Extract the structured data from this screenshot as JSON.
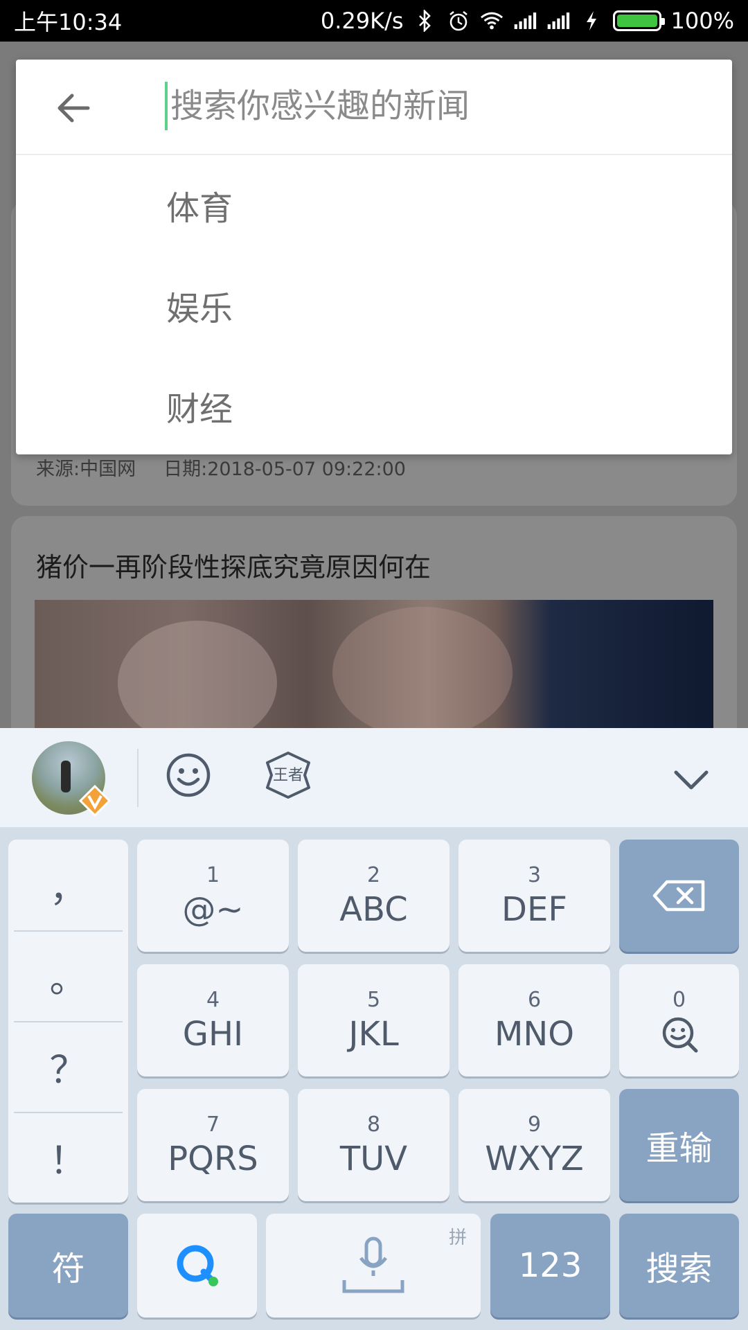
{
  "status_bar": {
    "time": "上午10:34",
    "net_speed": "0.29K/s",
    "battery": "100%",
    "battery_color": "#3ec43e"
  },
  "background": {
    "card1_meta": {
      "source": "来源:中国网",
      "date": "日期:2018-05-07 09:22:00"
    },
    "card2_title": "猪价一再阶段性探底究竟原因何在"
  },
  "search": {
    "back_icon": "arrow-left-icon",
    "placeholder": "搜索你感兴趣的新闻",
    "value": "",
    "cursor_color": "#5ad28a",
    "suggestions": [
      "体育",
      "娱乐",
      "财经"
    ]
  },
  "keyboard": {
    "toolbar": {
      "icons": [
        "avatar",
        "smiley-icon",
        "game-icon",
        "chevron-down-icon"
      ],
      "game_label": "王者"
    },
    "punctuation": [
      "，",
      "。",
      "？",
      "！"
    ],
    "keys": [
      {
        "num": "1",
        "letters": "@~"
      },
      {
        "num": "2",
        "letters": "ABC"
      },
      {
        "num": "3",
        "letters": "DEF"
      },
      {
        "num": "4",
        "letters": "GHI"
      },
      {
        "num": "5",
        "letters": "JKL"
      },
      {
        "num": "6",
        "letters": "MNO"
      },
      {
        "num": "7",
        "letters": "PQRS"
      },
      {
        "num": "8",
        "letters": "TUV"
      },
      {
        "num": "9",
        "letters": "WXYZ"
      }
    ],
    "zero": {
      "num": "0"
    },
    "reinput": "重输",
    "symbols": "符",
    "space_tag": "拼",
    "numbers": "123",
    "search": "搜索",
    "accent": "#89a3c3"
  }
}
